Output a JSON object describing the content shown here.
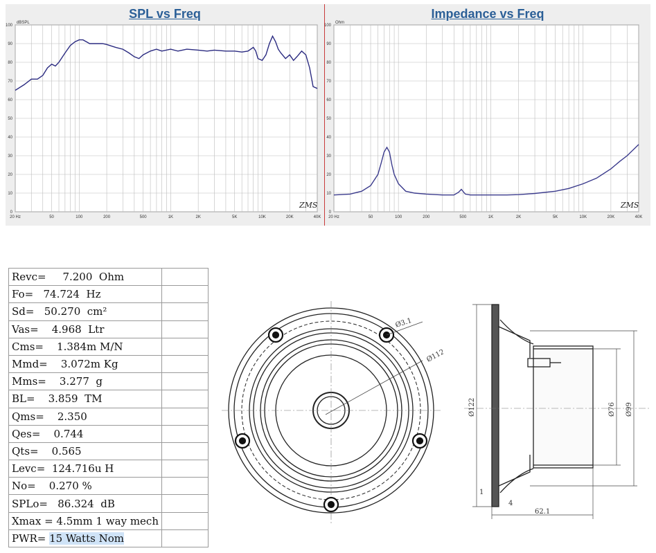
{
  "charts": {
    "spl": {
      "title": "SPL vs Freq",
      "ylabel": "dBSPL",
      "watermark": "ZMS"
    },
    "impedance": {
      "title": "Impedance vs Freq",
      "ylabel": "Ohm",
      "watermark": "ZMS"
    }
  },
  "chart_data": [
    {
      "type": "line",
      "title": "SPL vs Freq",
      "ylabel": "dBSPL",
      "xscale": "log",
      "xlim": [
        20,
        40000
      ],
      "ylim": [
        0,
        100
      ],
      "grid": true,
      "xticks": [
        "20 Hz",
        "50",
        "100",
        "200",
        "500",
        "1K",
        "2K",
        "5K",
        "10K",
        "20K",
        "40K"
      ],
      "yticks": [
        "0",
        "10",
        "20",
        "30",
        "40",
        "50",
        "60",
        "70",
        "80",
        "90",
        "100"
      ],
      "line_color": "#2a2a80",
      "x": [
        20,
        25,
        30,
        35,
        40,
        45,
        50,
        55,
        60,
        70,
        80,
        90,
        100,
        110,
        130,
        150,
        180,
        200,
        250,
        300,
        350,
        400,
        450,
        500,
        600,
        700,
        800,
        1000,
        1200,
        1500,
        2000,
        2500,
        3000,
        4000,
        5000,
        6000,
        7000,
        8000,
        8500,
        9000,
        10000,
        11000,
        12000,
        13000,
        14000,
        15000,
        16000,
        18000,
        20000,
        22000,
        24000,
        27000,
        30000,
        33000,
        36000,
        40000
      ],
      "y": [
        65,
        68,
        71,
        71,
        73,
        77,
        79,
        78,
        80,
        85,
        89,
        91,
        92,
        92,
        90,
        90,
        90,
        89.5,
        88,
        87,
        85,
        83,
        82,
        84,
        86,
        87,
        86,
        87,
        86,
        87,
        86.5,
        86,
        86.5,
        86,
        86,
        85.5,
        86,
        88,
        86,
        82,
        81,
        84,
        90,
        94,
        91,
        87,
        85,
        82,
        84,
        81,
        83,
        86,
        84,
        77,
        67,
        66
      ]
    },
    {
      "type": "line",
      "title": "Impedance vs Freq",
      "ylabel": "Ohm",
      "xscale": "log",
      "xlim": [
        20,
        40000
      ],
      "ylim": [
        0,
        100
      ],
      "grid": true,
      "xticks": [
        "20 Hz",
        "50",
        "100",
        "200",
        "500",
        "1K",
        "2K",
        "5K",
        "10K",
        "20K",
        "40K"
      ],
      "yticks": [
        "0",
        "10",
        "20",
        "30",
        "40",
        "50",
        "60",
        "70",
        "80",
        "90",
        "100"
      ],
      "line_color": "#3a3a8c",
      "x": [
        20,
        30,
        40,
        50,
        60,
        65,
        70,
        75,
        80,
        85,
        90,
        100,
        120,
        150,
        200,
        300,
        400,
        450,
        480,
        500,
        530,
        600,
        800,
        1000,
        1500,
        2000,
        3000,
        5000,
        7000,
        10000,
        14000,
        20000,
        25000,
        30000,
        40000
      ],
      "y": [
        9,
        9.5,
        11,
        14,
        20,
        26,
        32,
        34.5,
        32,
        25,
        20,
        15,
        11,
        10,
        9.5,
        9,
        9,
        10.5,
        12,
        11,
        9.5,
        9,
        9,
        9,
        9,
        9.2,
        9.8,
        11,
        12.5,
        15,
        18,
        23,
        27,
        30,
        36
      ]
    }
  ],
  "params": [
    {
      "text": "Revc=     7.200  Ohm",
      "highlight": ""
    },
    {
      "text": "Fo=   74.724  Hz",
      "highlight": ""
    },
    {
      "text": "Sd=   50.270  cm²",
      "highlight": ""
    },
    {
      "text": "Vas=    4.968  Ltr",
      "highlight": ""
    },
    {
      "text": "Cms=    1.384m M/N",
      "highlight": ""
    },
    {
      "text": "Mmd=    3.072m Kg",
      "highlight": ""
    },
    {
      "text": "Mms=    3.277  g",
      "highlight": ""
    },
    {
      "text": "BL=    3.859  TM",
      "highlight": ""
    },
    {
      "text": "Qms=    2.350",
      "highlight": ""
    },
    {
      "text": "Qes=    0.744",
      "highlight": ""
    },
    {
      "text": "Qts=    0.565",
      "highlight": ""
    },
    {
      "text": "Levc=  124.716u H",
      "highlight": ""
    },
    {
      "text": "No=    0.270 %",
      "highlight": ""
    },
    {
      "text": "SPLo=   86.324  dB",
      "highlight": ""
    },
    {
      "text": "Xmax = 4.5mm 1 way mech",
      "highlight": ""
    },
    {
      "text": "PWR= ",
      "highlight": "15 Watts Nom"
    }
  ],
  "drawing": {
    "front": {
      "dim_hole": "Ø3.1",
      "dim_bolt": "Ø112"
    },
    "side": {
      "dim_outer": "Ø122",
      "dim_magnet": "Ø76",
      "dim_basket": "Ø99",
      "dim_flange": "1",
      "dim_lip": "4",
      "dim_depth": "62.1"
    }
  }
}
